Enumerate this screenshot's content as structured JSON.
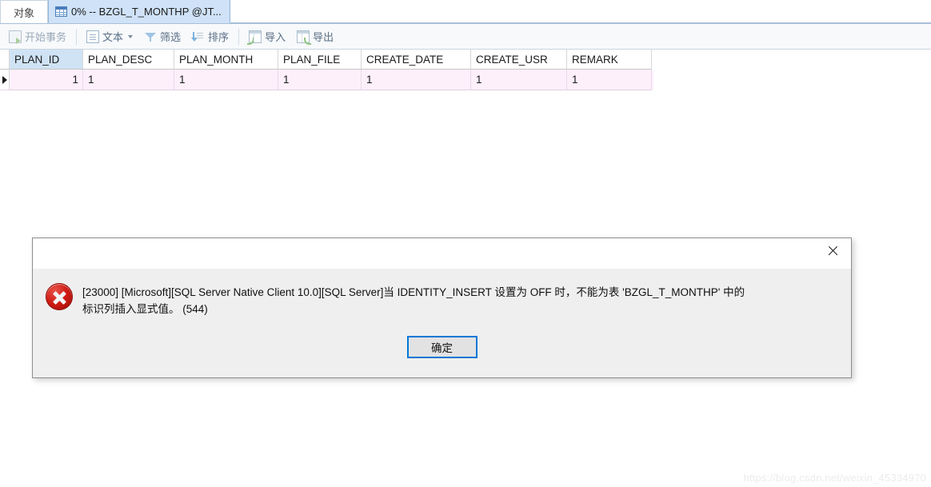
{
  "tabs": {
    "object_tab": "对象",
    "active_tab": "0% -- BZGL_T_MONTHP @JT...",
    "active_tab_icon": "grid-table-icon"
  },
  "toolbar": {
    "begin_transaction": "开始事务",
    "begin_transaction_icon": "transaction-icon",
    "text": "文本",
    "text_icon": "document-icon",
    "filter": "筛选",
    "filter_icon": "funnel-icon",
    "sort": "排序",
    "sort_icon": "sort-icon",
    "import": "导入",
    "import_icon": "table-import-icon",
    "export": "导出",
    "export_icon": "table-export-icon"
  },
  "grid": {
    "columns": [
      {
        "name": "PLAN_ID",
        "width": 92,
        "selected": true
      },
      {
        "name": "PLAN_DESC",
        "width": 114,
        "selected": false
      },
      {
        "name": "PLAN_MONTH",
        "width": 130,
        "selected": false
      },
      {
        "name": "PLAN_FILE",
        "width": 104,
        "selected": false
      },
      {
        "name": "CREATE_DATE",
        "width": 137,
        "selected": false
      },
      {
        "name": "CREATE_USR",
        "width": 120,
        "selected": false
      },
      {
        "name": "REMARK",
        "width": 106,
        "selected": false
      }
    ],
    "rows": [
      {
        "PLAN_ID": "1",
        "PLAN_DESC": "1",
        "PLAN_MONTH": "1",
        "PLAN_FILE": "1",
        "CREATE_DATE": "1",
        "CREATE_USR": "1",
        "REMARK": "1"
      }
    ],
    "row_indicator": "current-row-arrow",
    "editing_row_color": "#fdf0fa",
    "selected_header_color": "#cfe3f5"
  },
  "dialog": {
    "close_icon": "close-icon",
    "error_icon": "error-circle-icon",
    "message_line1": "[23000] [Microsoft][SQL Server Native Client 10.0][SQL Server]当 IDENTITY_INSERT 设置为 OFF 时，不能为表 'BZGL_T_MONTHP' 中的",
    "message_line2": "标识列插入显式值。 (544)",
    "ok_button": "确定",
    "accent_color": "#0078d7",
    "error_color": "#cf1b14"
  },
  "watermark": {
    "text": "https://blog.csdn.net/weixin_45334970"
  }
}
